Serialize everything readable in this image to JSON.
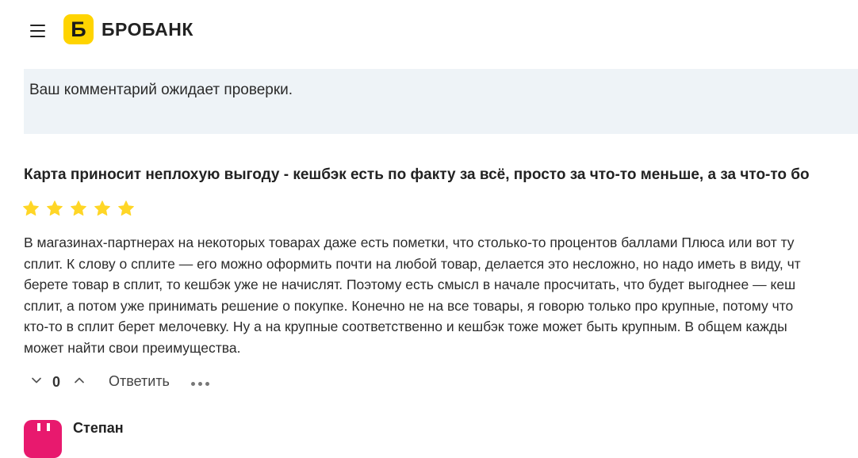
{
  "header": {
    "menu_icon": "hamburger-menu-icon",
    "logo_letter": "Б",
    "logo_text": "БРОБАНК",
    "brand_color": "#ffd400"
  },
  "notice": {
    "text": "Ваш комментарий ожидает проверки."
  },
  "review": {
    "title": "Карта приносит неплохую выгоду - кешбэк есть по факту за всё, просто за что-то меньше, а за что-то бо",
    "rating": 5,
    "rating_max": 5,
    "star_color": "#ffd626",
    "body_lines": [
      "В магазинах-партнерах на некоторых товарах даже есть пометки, что столько-то процентов баллами Плюса или вот ту",
      "сплит. К слову о сплите — его можно оформить почти на любой товар, делается это несложно, но надо иметь в виду, чт",
      "берете товар в сплит, то кешбэк уже не начислят. Поэтому есть смысл в начале просчитать, что будет выгоднее — кеш",
      "сплит, а потом уже принимать решение о покупке. Конечно не на все товары, я говорю только про крупные, потому что",
      "кто-то в сплит берет мелочевку. Ну а на крупные соответственно и кешбэк тоже может быть крупным. В общем кажды",
      "может найти свои преимущества."
    ],
    "actions": {
      "vote_down_icon": "chevron-down-icon",
      "vote_count": "0",
      "vote_up_icon": "chevron-up-icon",
      "reply_label": "Ответить",
      "more_icon": "more-dots-icon"
    }
  },
  "next_comment": {
    "author": "Степан",
    "avatar_color": "#e8196e"
  }
}
